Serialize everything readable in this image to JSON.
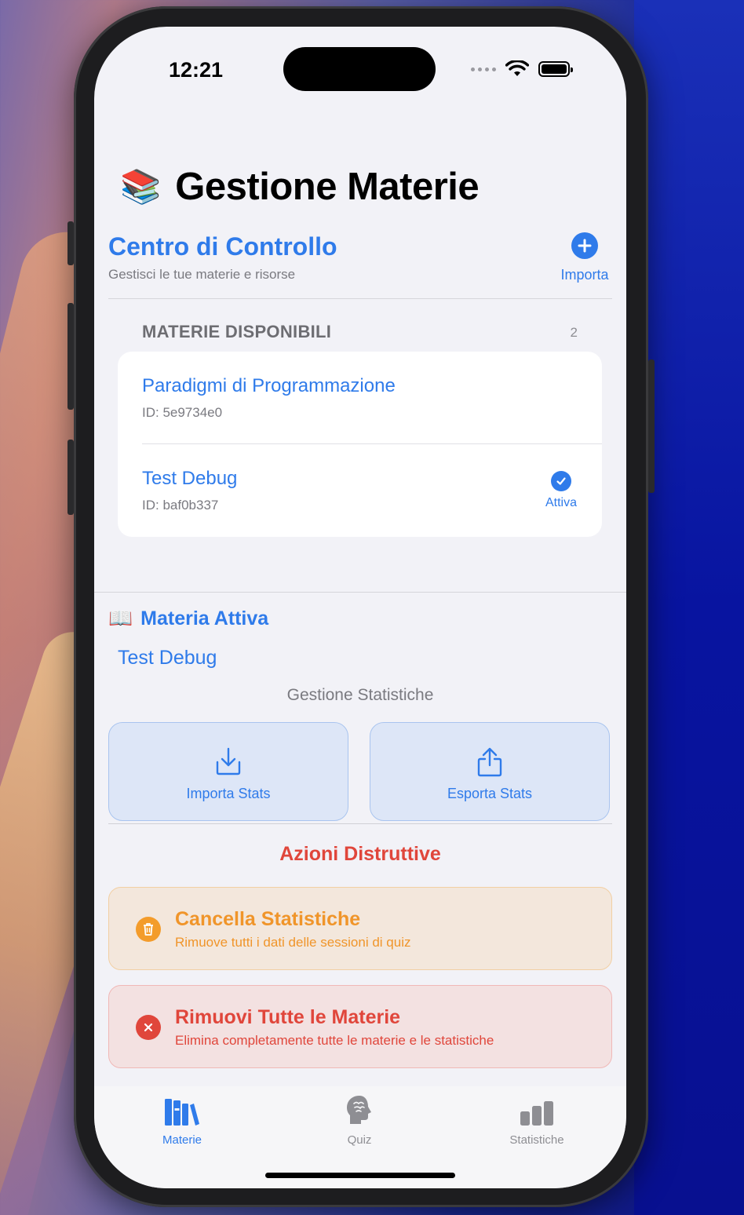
{
  "status": {
    "time": "12:21"
  },
  "header": {
    "emoji": "📚",
    "title": "Gestione Materie"
  },
  "control": {
    "title": "Centro di Controllo",
    "subtitle": "Gestisci le tue materie e risorse",
    "import_label": "Importa"
  },
  "materie": {
    "header": "MATERIE DISPONIBILI",
    "count": "2",
    "items": [
      {
        "name": "Paradigmi di Programmazione",
        "id": "ID: 5e9734e0"
      },
      {
        "name": "Test Debug",
        "id": "ID: baf0b337",
        "badge": "Attiva"
      }
    ]
  },
  "active": {
    "emoji": "📖",
    "title": "Materia Attiva",
    "value": "Test Debug"
  },
  "stats": {
    "label": "Gestione Statistiche",
    "import_label": "Importa Stats",
    "export_label": "Esporta Stats"
  },
  "destructive": {
    "title": "Azioni Distruttive",
    "clear_title": "Cancella Statistiche",
    "clear_sub": "Rimuove tutti i dati delle sessioni di quiz",
    "remove_title": "Rimuovi Tutte le Materie",
    "remove_sub": "Elimina completamente tutte le materie e le statistiche"
  },
  "tabs": [
    {
      "label": "Materie",
      "icon": "books-vertical-icon",
      "active": true
    },
    {
      "label": "Quiz",
      "icon": "brain-head-icon",
      "active": false
    },
    {
      "label": "Statistiche",
      "icon": "chart-bar-icon",
      "active": false
    }
  ],
  "colors": {
    "accent": "#2f7bea",
    "warning": "#f0952a",
    "danger": "#e0463b",
    "inactive_tab": "#8e8e93"
  }
}
